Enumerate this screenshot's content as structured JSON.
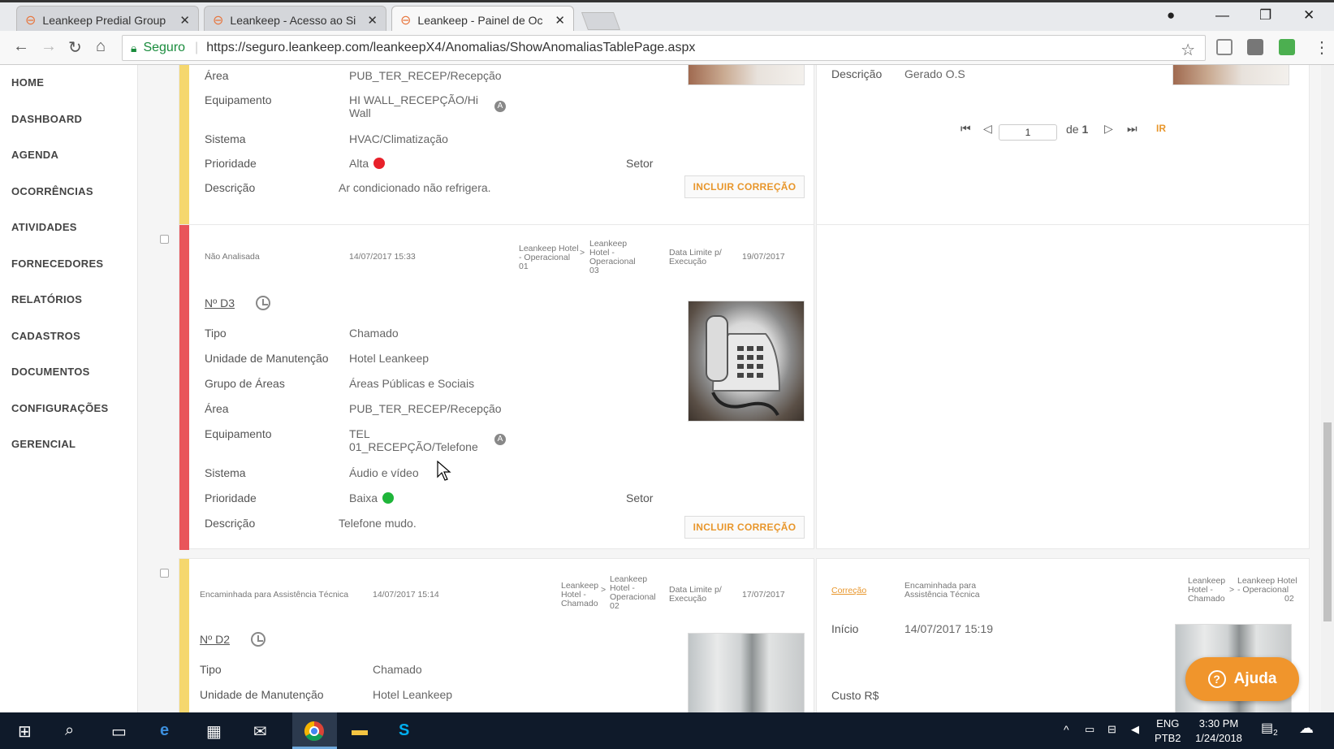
{
  "browser": {
    "tabs": [
      {
        "title": "Leankeep Predial Group"
      },
      {
        "title": "Leankeep - Acesso ao Si"
      },
      {
        "title": "Leankeep - Painel de Oc"
      }
    ],
    "secure_label": "Seguro",
    "url": "https://seguro.leankeep.com/leankeepX4/Anomalias/ShowAnomaliasTablePage.aspx"
  },
  "sidebar": {
    "items": [
      "HOME",
      "DASHBOARD",
      "AGENDA",
      "OCORRÊNCIAS",
      "ATIVIDADES",
      "FORNECEDORES",
      "RELATÓRIOS",
      "CADASTROS",
      "DOCUMENTOS",
      "CONFIGURAÇÕES",
      "GERENCIAL"
    ]
  },
  "card1": {
    "area_label": "Área",
    "area_value": "PUB_TER_RECEP/Recepção",
    "equip_label": "Equipamento",
    "equip_value_1": "HI WALL_RECEPÇÃO/Hi",
    "equip_value_2": "Wall",
    "sistema_label": "Sistema",
    "sistema_value": "HVAC/Climatização",
    "prioridade_label": "Prioridade",
    "prioridade_value": "Alta",
    "prioridade_color": "#e8202a",
    "setor_label": "Setor",
    "descricao_label": "Descrição",
    "descricao_value": "Ar condicionado não refrigera.",
    "button": "INCLUIR CORREÇÃO",
    "bar_color": "#f5d76e"
  },
  "card1_right": {
    "descricao_label": "Descrição",
    "descricao_value": "Gerado O.S",
    "pager": {
      "page": "1",
      "of_label": "de",
      "total": "1",
      "go": "IR"
    }
  },
  "card2": {
    "status": "Não Analisada",
    "datetime": "14/07/2017 15:33",
    "from_1": "Leankeep Hotel",
    "from_2": "- Operacional",
    "from_3": "01",
    "arrow": ">",
    "to_1": "Leankeep",
    "to_2": "Hotel -",
    "to_3": "Operacional",
    "to_4": "03",
    "deadline_label_1": "Data Limite p/",
    "deadline_label_2": "Execução",
    "deadline": "19/07/2017",
    "number": "Nº D3",
    "tipo_label": "Tipo",
    "tipo_value": "Chamado",
    "unidade_label": "Unidade de Manutenção",
    "unidade_value": "Hotel Leankeep",
    "grupo_label": "Grupo de Áreas",
    "grupo_value": "Áreas Públicas e Sociais",
    "area_label": "Área",
    "area_value": "PUB_TER_RECEP/Recepção",
    "equip_label": "Equipamento",
    "equip_value_1": "TEL",
    "equip_value_2": "01_RECEPÇÃO/Telefone",
    "sistema_label": "Sistema",
    "sistema_value": "Áudio e vídeo",
    "prioridade_label": "Prioridade",
    "prioridade_value": "Baixa",
    "prioridade_color": "#1fb53a",
    "setor_label": "Setor",
    "descricao_label": "Descrição",
    "descricao_value": "Telefone mudo.",
    "button": "INCLUIR CORREÇÃO",
    "bar_color": "#e9555a"
  },
  "card3": {
    "status": "Encaminhada para Assistência Técnica",
    "datetime": "14/07/2017 15:14",
    "from_1": "Leankeep",
    "from_2": "Hotel -",
    "from_3": "Chamado",
    "arrow": ">",
    "to_1": "Leankeep",
    "to_2": "Hotel -",
    "to_3": "Operacional",
    "to_4": "02",
    "deadline_label_1": "Data Limite p/",
    "deadline_label_2": "Execução",
    "deadline": "17/07/2017",
    "number": "Nº D2",
    "tipo_label": "Tipo",
    "tipo_value": "Chamado",
    "unidade_label": "Unidade de Manutenção",
    "unidade_value": "Hotel Leankeep",
    "bar_color": "#f5d76e"
  },
  "card3_right": {
    "correcao": "Correção",
    "status_1": "Encaminhada para",
    "status_2": "Assistência Técnica",
    "from_1": "Leankeep",
    "from_2": "Hotel -",
    "from_3": "Chamado",
    "arrow": ">",
    "to_1": "Leankeep Hotel",
    "to_2": "- Operacional",
    "to_3": "02",
    "inicio_label": "Início",
    "inicio_value": "14/07/2017 15:19",
    "custo_label": "Custo R$"
  },
  "help": {
    "label": "Ajuda"
  },
  "taskbar": {
    "lang_1": "ENG",
    "lang_2": "PTB2",
    "time": "3:30 PM",
    "date": "1/24/2018",
    "notifications": "2"
  }
}
